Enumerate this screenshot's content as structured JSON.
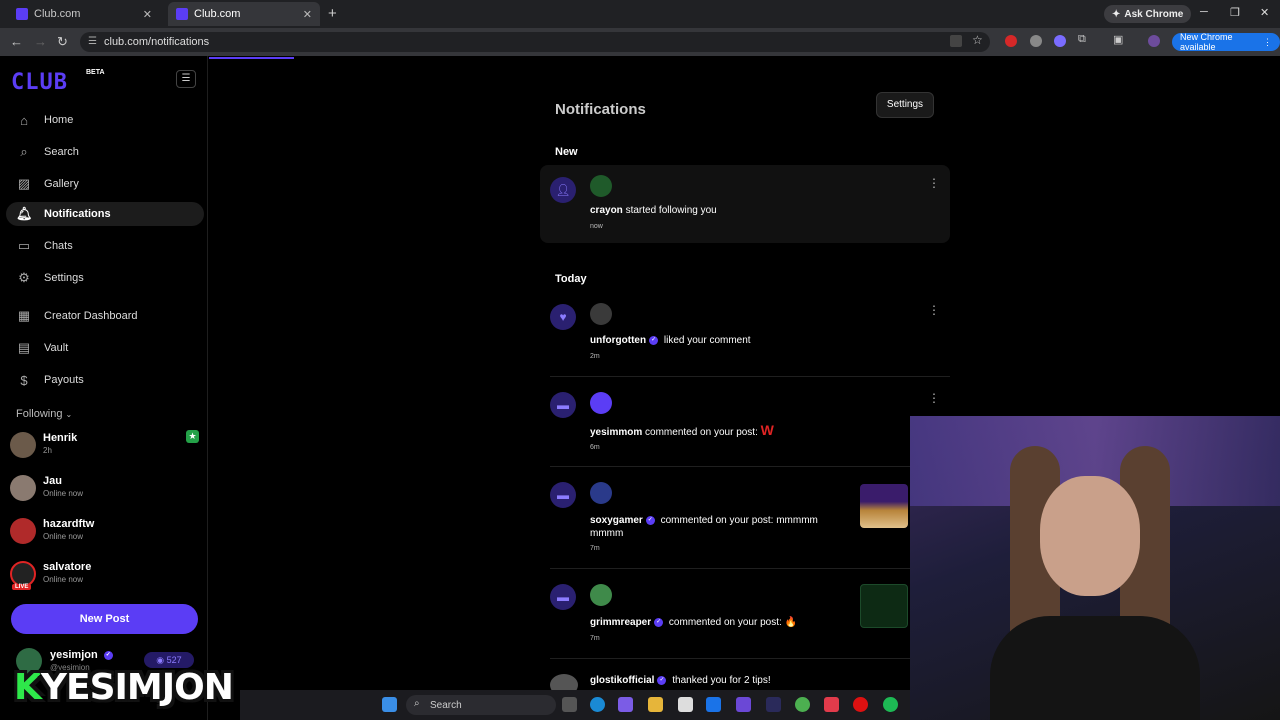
{
  "browser": {
    "tabs": [
      {
        "label": "Club.com"
      },
      {
        "label": "Club.com"
      }
    ],
    "ask_chrome": "Ask Chrome",
    "url": "club.com/notifications",
    "new_chrome": "New Chrome available"
  },
  "sidebar": {
    "logo": "CLUB",
    "beta": "BETA",
    "nav": [
      {
        "label": "Home",
        "icon": "home-icon"
      },
      {
        "label": "Search",
        "icon": "search-icon"
      },
      {
        "label": "Gallery",
        "icon": "gallery-icon"
      },
      {
        "label": "Notifications",
        "icon": "bell-icon"
      },
      {
        "label": "Chats",
        "icon": "chat-icon"
      },
      {
        "label": "Settings",
        "icon": "gear-icon"
      },
      {
        "label": "Creator Dashboard",
        "icon": "dashboard-icon"
      },
      {
        "label": "Vault",
        "icon": "vault-icon"
      },
      {
        "label": "Payouts",
        "icon": "dollar-icon"
      }
    ],
    "following_header": "Following",
    "following": [
      {
        "name": "Henrik",
        "status": "2h"
      },
      {
        "name": "Jau",
        "status": "Online now"
      },
      {
        "name": "hazardftw",
        "status": "Online now"
      },
      {
        "name": "salvatore",
        "status": "Online now",
        "live": "LIVE"
      }
    ],
    "new_post": "New Post",
    "me": {
      "name": "yesimjon",
      "handle": "@yesimjon",
      "credits": "527"
    }
  },
  "main": {
    "title": "Notifications",
    "settings_button": "Settings",
    "section_new": "New",
    "section_today": "Today",
    "notifications": [
      {
        "user": "crayon",
        "text": "started following you",
        "time": "now",
        "kind": "follow"
      },
      {
        "user": "unforgotten",
        "text": "liked your comment",
        "time": "2m",
        "kind": "like"
      },
      {
        "user": "yesimmom",
        "text": "commented on your post:",
        "extra": "W",
        "time": "6m",
        "kind": "comment"
      },
      {
        "user": "soxygamer",
        "text": "commented on your post: mmmmm mmmm",
        "time": "7m",
        "kind": "comment"
      },
      {
        "user": "grimmreaper",
        "text": "commented on your post:",
        "extra": "🔥",
        "time": "7m",
        "kind": "comment"
      },
      {
        "user": "glostikofficial",
        "text": "thanked you for 2 tips!",
        "kind": "tip"
      }
    ]
  },
  "overlay": {
    "streamer_name_prefix": "K",
    "streamer_name": "YESIMJON"
  },
  "taskbar": {
    "search": "Search"
  }
}
